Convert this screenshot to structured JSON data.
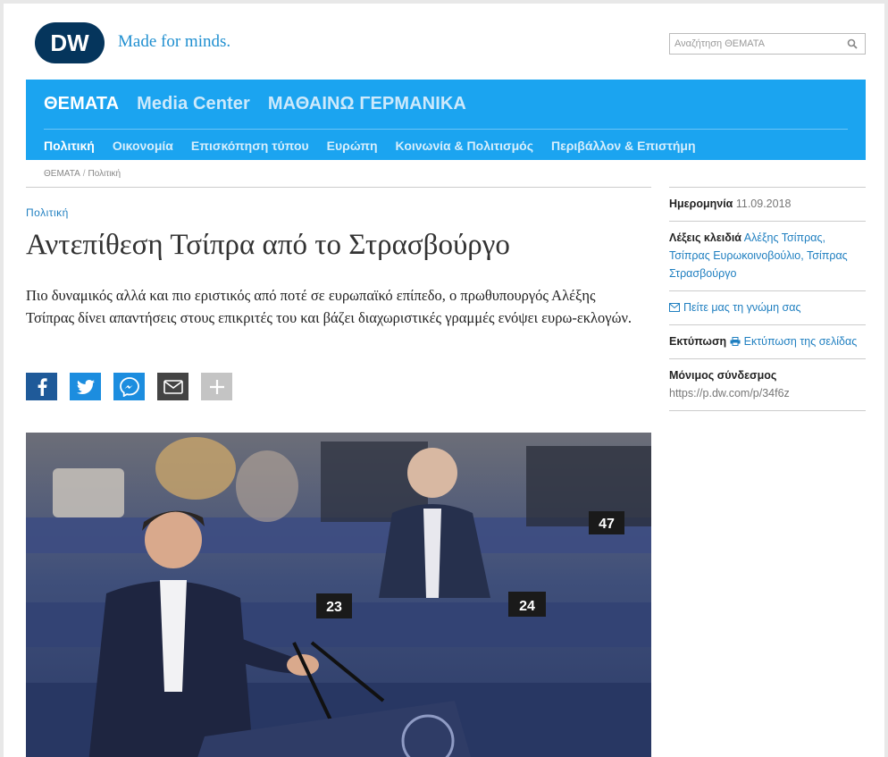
{
  "header": {
    "logo_text": "DW",
    "tagline": "Made for minds.",
    "search_placeholder": "Αναζήτηση ΘΕΜΑΤΑ",
    "brand_color": "#05355c",
    "accent_color": "#1ba4f0"
  },
  "nav": {
    "primary": [
      "ΘΕΜΑΤΑ",
      "Media Center",
      "ΜΑΘΑΙΝΩ ΓΕΡΜΑΝΙΚΑ"
    ],
    "secondary": [
      "Πολιτική",
      "Οικονομία",
      "Επισκόπηση τύπου",
      "Ευρώπη",
      "Κοινωνία & Πολιτισμός",
      "Περιβάλλον & Επιστήμη"
    ]
  },
  "breadcrumb": [
    "ΘΕΜΑΤΑ",
    "Πολιτική"
  ],
  "article": {
    "kicker": "Πολιτική",
    "headline": "Αντεπίθεση Τσίπρα από το Στρασβούργο",
    "intro": "Πιο δυναμικός αλλά και πιο εριστικός από ποτέ σε ευρωπαϊκό επίπεδο, ο πρωθυπουργός Αλέξης Τσίπρας δίνει απαντήσεις στους επικριτές του και βάζει διαχωριστικές γραμμές ενόψει ευρω-εκλογών.",
    "share_icons": [
      "facebook-icon",
      "twitter-icon",
      "messenger-icon",
      "email-icon",
      "plus-icon"
    ],
    "photo_desc_icon": "photo",
    "seat_numbers": [
      "47",
      "23",
      "24"
    ]
  },
  "sidebar": {
    "date_label": "Ημερομηνία",
    "date_value": "11.09.2018",
    "keywords_label": "Λέξεις κλειδιά",
    "keywords": [
      "Αλέξης Τσίπρας,",
      "Τσίπρας Ευρωκοινοβούλιο,",
      "Τσίπρας Στρασβούργο"
    ],
    "feedback_link": "Πείτε μας τη γνώμη σας",
    "print_label": "Εκτύπωση",
    "print_link": "Εκτύπωση της σελίδας",
    "permalink_label": "Μόνιμος σύνδεσμος",
    "permalink_value": "https://p.dw.com/p/34f6z"
  }
}
